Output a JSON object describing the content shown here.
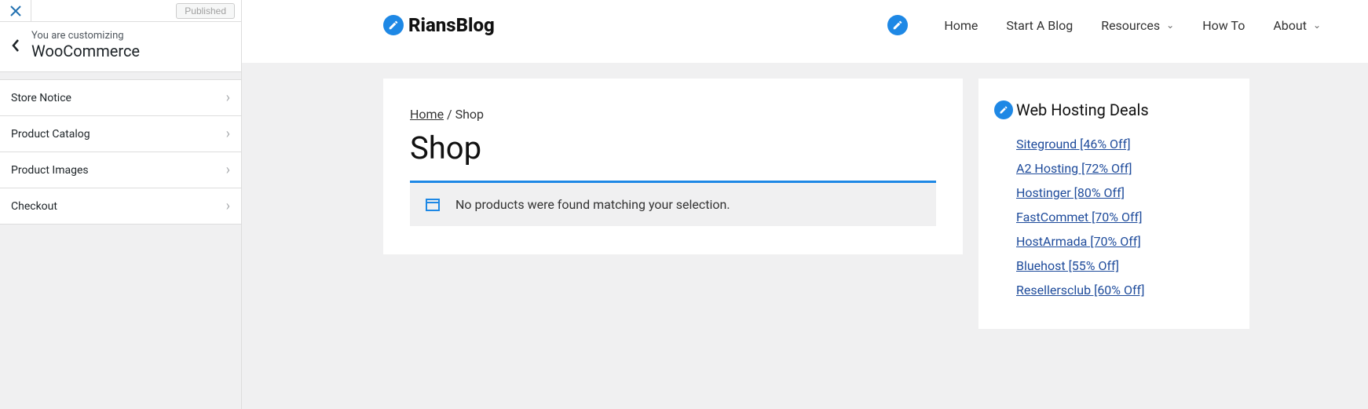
{
  "customizer": {
    "published_label": "Published",
    "you_are": "You are customizing",
    "title": "WooCommerce",
    "items": [
      {
        "label": "Store Notice"
      },
      {
        "label": "Product Catalog"
      },
      {
        "label": "Product Images"
      },
      {
        "label": "Checkout"
      }
    ]
  },
  "site": {
    "logo_text": "RiansBlog",
    "nav": [
      {
        "label": "Home",
        "dropdown": false
      },
      {
        "label": "Start A Blog",
        "dropdown": false
      },
      {
        "label": "Resources",
        "dropdown": true
      },
      {
        "label": "How To",
        "dropdown": false
      },
      {
        "label": "About",
        "dropdown": true
      }
    ]
  },
  "breadcrumb": {
    "home": "Home",
    "sep": " / ",
    "current": "Shop"
  },
  "page": {
    "title": "Shop",
    "notice": "No products were found matching your selection."
  },
  "widget": {
    "title": "Web Hosting Deals",
    "links": [
      "Siteground [46% Off]",
      "A2 Hosting [72% Off]",
      "Hostinger [80% Off]",
      "FastCommet [70% Off]",
      "HostArmada [70% Off]",
      "Bluehost [55% Off]",
      "Resellersclub [60% Off]"
    ]
  }
}
